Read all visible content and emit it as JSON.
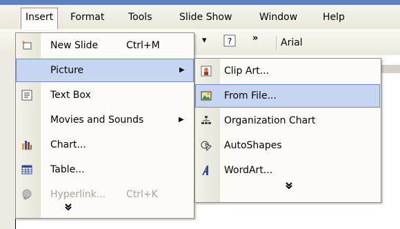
{
  "menubar": {
    "items": [
      {
        "label": "Insert"
      },
      {
        "label": "Format"
      },
      {
        "label": "Tools"
      },
      {
        "label": "Slide Show"
      },
      {
        "label": "Window"
      },
      {
        "label": "Help"
      }
    ]
  },
  "toolbar": {
    "font_name": "Arial",
    "help_icon": "help-icon",
    "overflow_glyph": "»"
  },
  "insert_menu": {
    "items": [
      {
        "label": "New Slide",
        "accel": "Ctrl+M",
        "icon": "new-slide-icon"
      },
      {
        "label": "Picture",
        "icon": "",
        "submenu": true
      },
      {
        "label": "Text Box",
        "icon": "text-box-icon"
      },
      {
        "label": "Movies and Sounds",
        "icon": "",
        "submenu": true
      },
      {
        "label": "Chart...",
        "icon": "chart-icon"
      },
      {
        "label": "Table...",
        "icon": "table-icon"
      },
      {
        "label": "Hyperlink...",
        "accel": "Ctrl+K",
        "icon": "hyperlink-icon",
        "disabled": true
      }
    ],
    "expand_glyph": "¥"
  },
  "picture_submenu": {
    "items": [
      {
        "label": "Clip Art...",
        "icon": "clip-art-icon"
      },
      {
        "label": "From File...",
        "icon": "from-file-icon"
      },
      {
        "label": "Organization Chart",
        "icon": "org-chart-icon"
      },
      {
        "label": "AutoShapes",
        "icon": "autoshapes-icon"
      },
      {
        "label": "WordArt...",
        "icon": "wordart-icon"
      }
    ],
    "expand_glyph": "¥"
  }
}
